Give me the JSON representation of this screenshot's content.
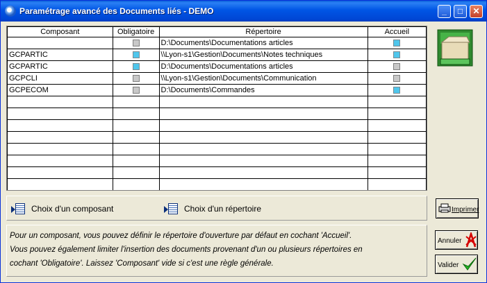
{
  "window": {
    "title": "Paramétrage avancé des Documents liés - DEMO",
    "minimize": "_",
    "maximize": "□",
    "close": "✕"
  },
  "grid": {
    "columns": [
      "Composant",
      "Obligatoire",
      "Répertoire",
      "Accueil"
    ],
    "rows": [
      {
        "composant": "",
        "obligatoire": false,
        "repertoire": "D:\\Documents\\Documentations articles",
        "accueil": true
      },
      {
        "composant": "GCPARTIC",
        "obligatoire": true,
        "repertoire": "\\\\Lyon-s1\\Gestion\\Documents\\Notes techniques",
        "accueil": true
      },
      {
        "composant": "GCPARTIC",
        "obligatoire": true,
        "repertoire": "D:\\Documents\\Documentations articles",
        "accueil": false
      },
      {
        "composant": "GCPCLI",
        "obligatoire": false,
        "repertoire": "\\\\Lyon-s1\\Gestion\\Documents\\Communication",
        "accueil": false
      },
      {
        "composant": "GCPECOM",
        "obligatoire": false,
        "repertoire": "D:\\Documents\\Commandes",
        "accueil": true
      }
    ],
    "empty_rows": 8
  },
  "buttons": {
    "choix_composant": "Choix d'un composant",
    "choix_repertoire": "Choix d'un répertoire",
    "imprimer": "Imprimer",
    "annuler": "Annuler",
    "valider": "Valider"
  },
  "info": {
    "line1": "Pour un composant, vous pouvez définir le répertoire d'ouverture par défaut en cochant 'Accueil'.",
    "line2": "Vous pouvez également limiter l'insertion des documents provenant d'un ou plusieurs répertoires en",
    "line3": "cochant 'Obligatoire'. Laissez 'Composant' vide si c'est une règle générale."
  }
}
